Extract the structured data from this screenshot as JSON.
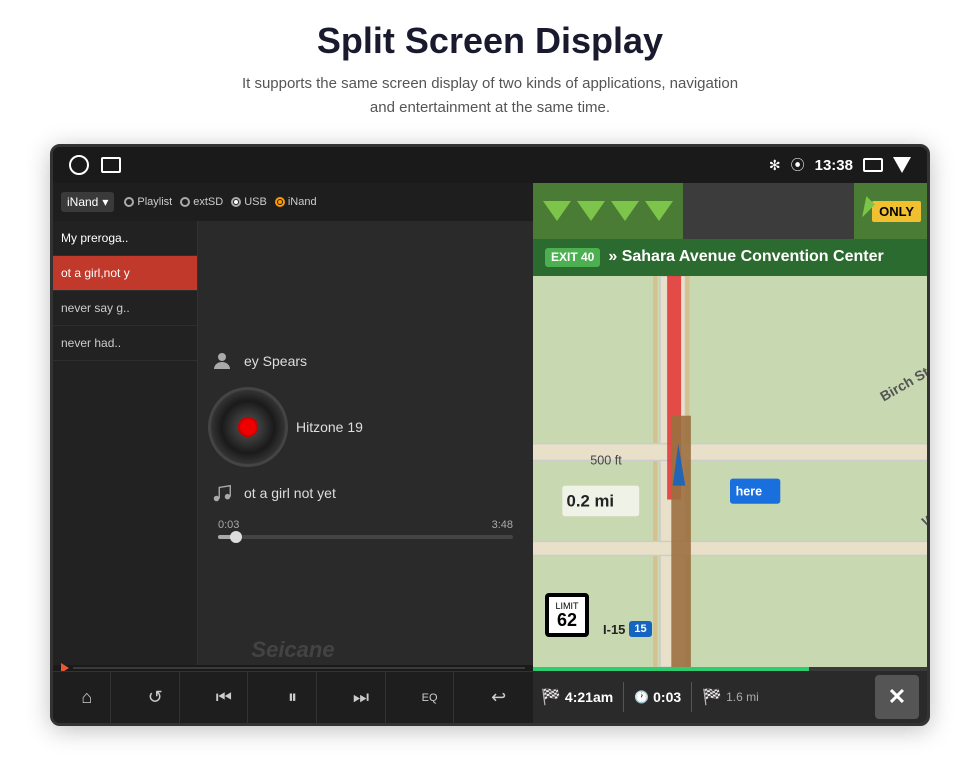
{
  "header": {
    "title": "Split Screen Display",
    "subtitle": "It supports the same screen display of two kinds of applications, navigation and entertainment at the same time."
  },
  "status_bar": {
    "time": "13:38",
    "icons": [
      "bluetooth",
      "location",
      "window",
      "back"
    ]
  },
  "music_player": {
    "source_dropdown_label": "iNand",
    "source_options": [
      {
        "label": "Playlist",
        "type": "white"
      },
      {
        "label": "extSD",
        "type": "white"
      },
      {
        "label": "USB",
        "type": "blue"
      },
      {
        "label": "iNand",
        "type": "orange"
      }
    ],
    "track_list": [
      {
        "label": "My preroga..",
        "active": false
      },
      {
        "label": "ot a girl,not y",
        "active": true
      },
      {
        "label": "never say g..",
        "active": false
      },
      {
        "label": "never had..",
        "active": false
      }
    ],
    "now_playing": {
      "artist": "ey Spears",
      "album": "Hitzone 19",
      "song": "ot a girl not yet"
    },
    "progress": {
      "current": "0:03",
      "total": "3:48",
      "percent": 6
    },
    "watermark": "Seicane",
    "controls": [
      {
        "id": "home",
        "icon": "⌂"
      },
      {
        "id": "repeat",
        "icon": "↺"
      },
      {
        "id": "prev",
        "icon": "⏮"
      },
      {
        "id": "pause",
        "icon": "⏸"
      },
      {
        "id": "next",
        "icon": "⏭"
      },
      {
        "id": "eq",
        "icon": "EQ"
      },
      {
        "id": "back",
        "icon": "↩"
      }
    ]
  },
  "navigation": {
    "direction_arrows": 4,
    "only_label": "ONLY",
    "exit_label": "EXIT 40",
    "exit_destination": "» Sahara Avenue Convention Center",
    "speed_limit": "62",
    "highway": "I-15",
    "highway_number": "15",
    "distance_display": "0.2 mi",
    "road_labels": [
      "Birch St",
      "Westwood"
    ],
    "bottom_bar": {
      "arrival_time": "4:21am",
      "trip_time": "0:03",
      "distance": "1.6 mi"
    }
  }
}
